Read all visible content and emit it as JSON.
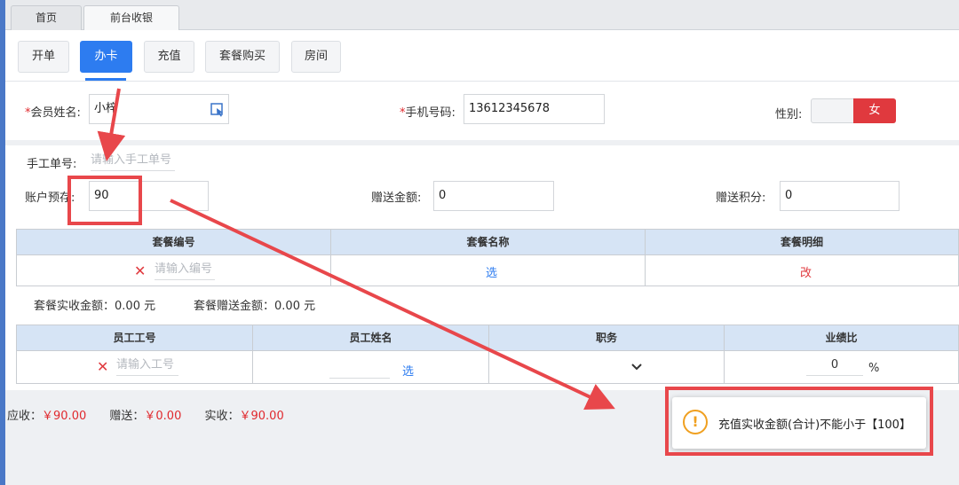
{
  "page_tabs": [
    {
      "label": "首页"
    },
    {
      "label": "前台收银"
    }
  ],
  "sub_tabs": [
    {
      "label": "开单"
    },
    {
      "label": "办卡"
    },
    {
      "label": "充值"
    },
    {
      "label": "套餐购买"
    },
    {
      "label": "房间"
    }
  ],
  "form": {
    "member_name_label": "会员姓名:",
    "member_name_value": "小梓",
    "phone_label": "手机号码:",
    "phone_value": "13612345678",
    "gender_label": "性别:",
    "gender_value": "女",
    "manual_no_label": "手工单号:",
    "manual_no_placeholder": "请输入手工单号",
    "deposit_label": "账户预存:",
    "deposit_value": "90",
    "gift_amount_label": "赠送金额:",
    "gift_amount_value": "0",
    "gift_points_label": "赠送积分:",
    "gift_points_value": "0"
  },
  "package_table": {
    "headers": [
      "套餐编号",
      "套餐名称",
      "套餐明细"
    ],
    "code_placeholder": "请输入编号",
    "select_link": "选",
    "edit_link": "改"
  },
  "package_summary": {
    "actual_label": "套餐实收金额：",
    "actual_value": "0.00 元",
    "gift_label": "套餐赠送金额：",
    "gift_value": "0.00 元"
  },
  "staff_table": {
    "headers": [
      "员工工号",
      "员工姓名",
      "职务",
      "业绩比"
    ],
    "id_placeholder": "请输入工号",
    "select_link": "选",
    "ratio_value": "0",
    "ratio_unit": "%"
  },
  "totals": {
    "due_label": "应收：",
    "due_value": "￥90.00",
    "gift_label": "赠送：",
    "gift_value": "￥0.00",
    "paid_label": "实收：",
    "paid_value": "￥90.00"
  },
  "toast": {
    "message": "充值实收金额(合计)不能小于【100】",
    "icon": "warning-icon"
  },
  "colors": {
    "accent": "#2d7cf0",
    "danger": "#e0393e",
    "annotation": "#e8474b",
    "warning": "#f0a020",
    "table_header": "#d6e4f5"
  }
}
